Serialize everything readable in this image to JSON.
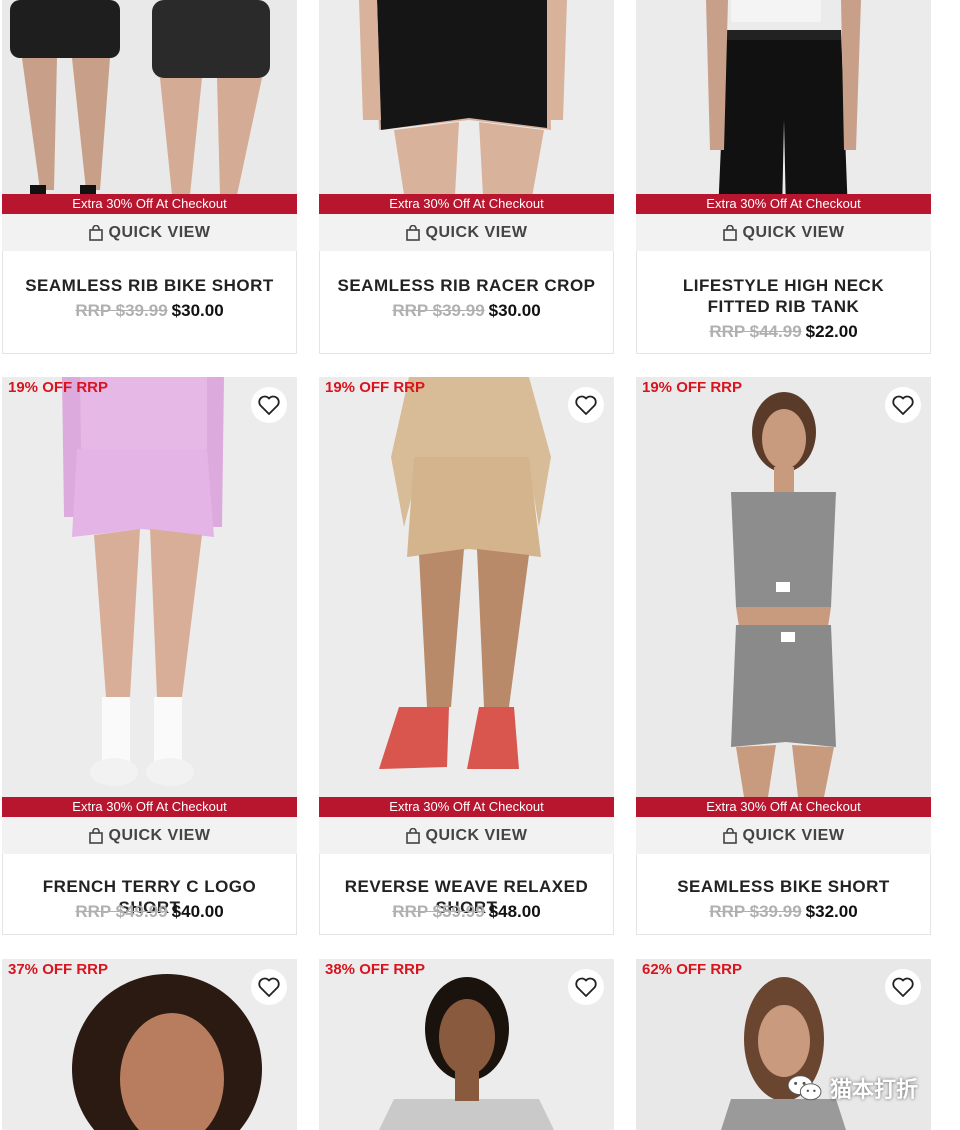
{
  "promo_label": "Extra 30% Off At Checkout",
  "quick_view_label": "QUICK VIEW",
  "rows": [
    {
      "products": [
        {
          "name": "SEAMLESS RIB BIKE SHORT",
          "rrp": "RRP $39.99",
          "price": "$30.00"
        },
        {
          "name": "SEAMLESS RIB RACER CROP",
          "rrp": "RRP $39.99",
          "price": "$30.00"
        },
        {
          "name": "LIFESTYLE HIGH NECK FITTED RIB TANK",
          "rrp": "RRP $44.99",
          "price": "$22.00"
        }
      ]
    },
    {
      "products": [
        {
          "discount": "19% OFF RRP",
          "name": "FRENCH TERRY C LOGO SHORT",
          "rrp": "RRP $49.99",
          "price": "$40.00"
        },
        {
          "discount": "19% OFF RRP",
          "name": "REVERSE WEAVE RELAXED SHORT",
          "rrp": "RRP $59.99",
          "price": "$48.00"
        },
        {
          "discount": "19% OFF RRP",
          "name": "SEAMLESS BIKE SHORT",
          "rrp": "RRP $39.99",
          "price": "$32.00"
        }
      ]
    },
    {
      "products": [
        {
          "discount": "37% OFF RRP"
        },
        {
          "discount": "38% OFF RRP"
        },
        {
          "discount": "62% OFF RRP"
        }
      ]
    }
  ],
  "watermark": "猫本打折",
  "colors": {
    "promo_bg": "#b8152f",
    "discount_text": "#d8141f",
    "rrp_text": "#b0b0b0",
    "quick_view_bg": "#f2f2f2"
  },
  "icons": {
    "heart": "heart-icon",
    "bag": "shopping-bag-icon",
    "wechat": "wechat-icon"
  }
}
